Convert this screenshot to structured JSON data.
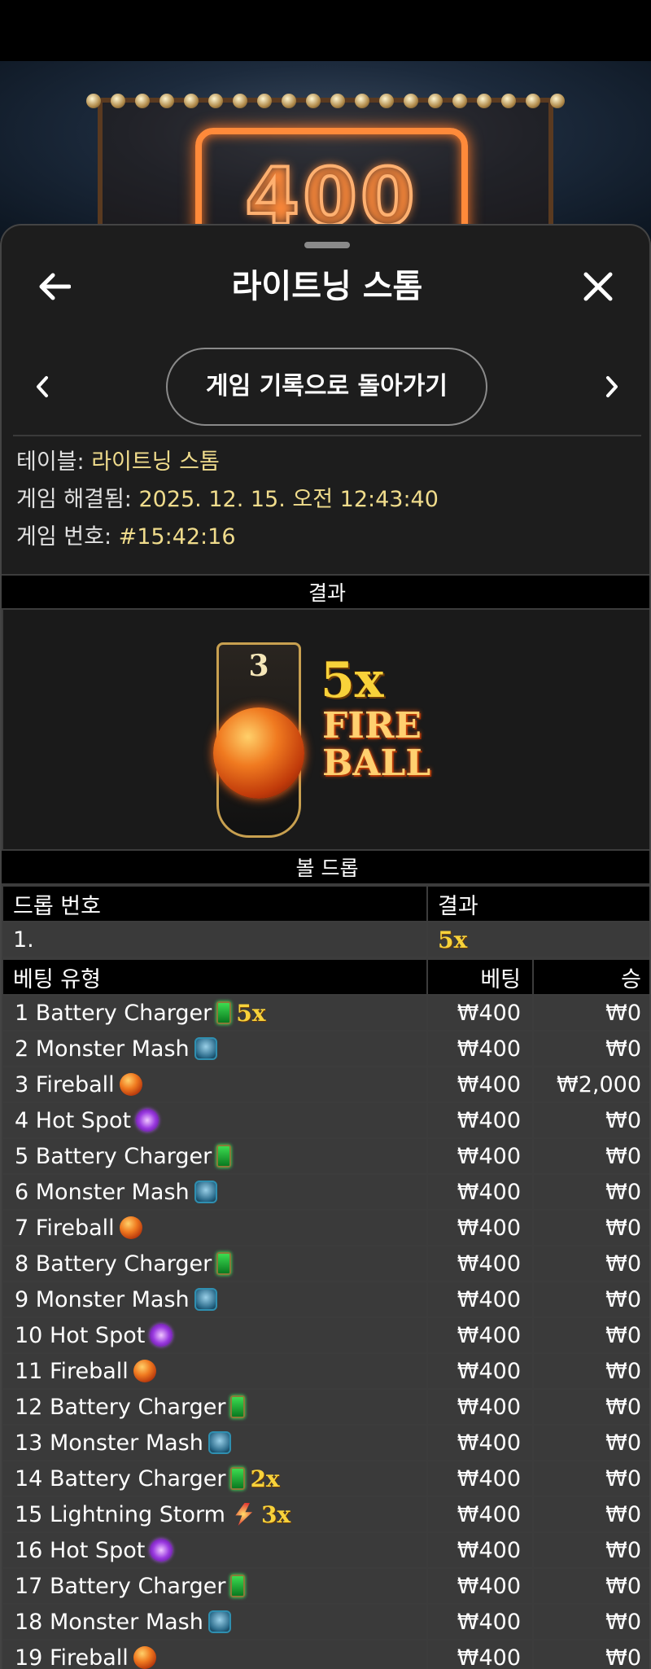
{
  "background": {
    "sign_text": "400"
  },
  "header": {
    "title": "라이트닝 스톰",
    "back_icon": "arrow-left-icon",
    "close_icon": "close-icon"
  },
  "nav": {
    "history_button": "게임 기록으로 돌아가기"
  },
  "info": [
    {
      "label": "테이블: ",
      "value": "라이트닝 스톰"
    },
    {
      "label": "게임 해결됨: ",
      "value": "2025. 12. 15. 오전 12:43:40"
    },
    {
      "label": "게임 번호: ",
      "value": "#15:42:16"
    }
  ],
  "result": {
    "band_label": "결과",
    "ball_number": "3",
    "multiplier": "5x",
    "type_line1": "FIRE",
    "type_line2": "BALL"
  },
  "ball_drop": {
    "band_label": "볼 드롭",
    "headers": [
      "드롭 번호",
      "결과"
    ],
    "rows": [
      {
        "drop": "1.",
        "result": "5x"
      }
    ]
  },
  "bets": {
    "headers": [
      "베팅 유형",
      "베팅",
      "승"
    ],
    "rows": [
      {
        "name": "1 Battery Charger",
        "icon": "battery",
        "mult": "5x",
        "bet": "₩400",
        "win": "₩0"
      },
      {
        "name": "2 Monster Mash",
        "icon": "monster",
        "mult": "",
        "bet": "₩400",
        "win": "₩0"
      },
      {
        "name": "3 Fireball",
        "icon": "fireball",
        "mult": "",
        "bet": "₩400",
        "win": "₩2,000"
      },
      {
        "name": "4 Hot Spot",
        "icon": "hotspot",
        "mult": "",
        "bet": "₩400",
        "win": "₩0"
      },
      {
        "name": "5 Battery Charger",
        "icon": "battery",
        "mult": "",
        "bet": "₩400",
        "win": "₩0"
      },
      {
        "name": "6 Monster Mash",
        "icon": "monster",
        "mult": "",
        "bet": "₩400",
        "win": "₩0"
      },
      {
        "name": "7 Fireball",
        "icon": "fireball",
        "mult": "",
        "bet": "₩400",
        "win": "₩0"
      },
      {
        "name": "8 Battery Charger",
        "icon": "battery",
        "mult": "",
        "bet": "₩400",
        "win": "₩0"
      },
      {
        "name": "9 Monster Mash",
        "icon": "monster",
        "mult": "",
        "bet": "₩400",
        "win": "₩0"
      },
      {
        "name": "10 Hot Spot",
        "icon": "hotspot",
        "mult": "",
        "bet": "₩400",
        "win": "₩0"
      },
      {
        "name": "11 Fireball",
        "icon": "fireball",
        "mult": "",
        "bet": "₩400",
        "win": "₩0"
      },
      {
        "name": "12 Battery Charger",
        "icon": "battery",
        "mult": "",
        "bet": "₩400",
        "win": "₩0"
      },
      {
        "name": "13 Monster Mash",
        "icon": "monster",
        "mult": "",
        "bet": "₩400",
        "win": "₩0"
      },
      {
        "name": "14 Battery Charger",
        "icon": "battery",
        "mult": "2x",
        "bet": "₩400",
        "win": "₩0"
      },
      {
        "name": "15 Lightning Storm",
        "icon": "lightning",
        "mult": "3x",
        "bet": "₩400",
        "win": "₩0"
      },
      {
        "name": "16 Hot Spot",
        "icon": "hotspot",
        "mult": "",
        "bet": "₩400",
        "win": "₩0"
      },
      {
        "name": "17 Battery Charger",
        "icon": "battery",
        "mult": "",
        "bet": "₩400",
        "win": "₩0"
      },
      {
        "name": "18 Monster Mash",
        "icon": "monster",
        "mult": "",
        "bet": "₩400",
        "win": "₩0"
      },
      {
        "name": "19 Fireball",
        "icon": "fireball",
        "mult": "",
        "bet": "₩400",
        "win": "₩0"
      }
    ]
  }
}
